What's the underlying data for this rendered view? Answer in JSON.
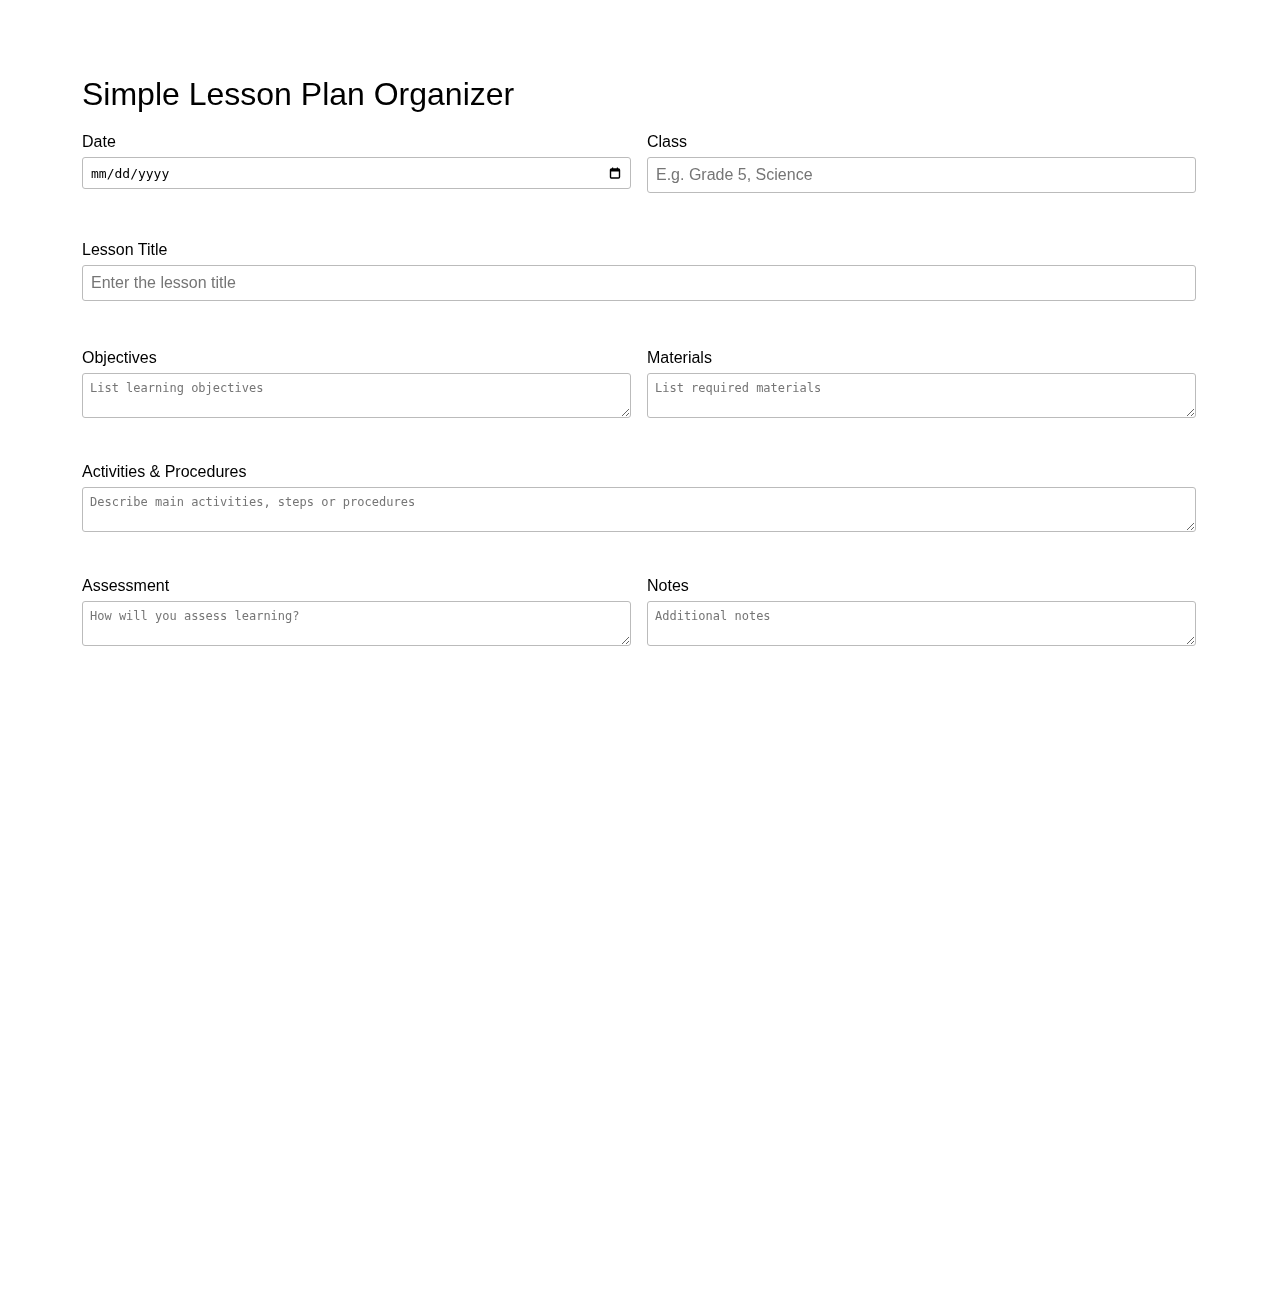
{
  "title": "Simple Lesson Plan Organizer",
  "rows": [
    {
      "fields": [
        {
          "label": "Date",
          "kind": "date",
          "placeholder": "mm/dd/yyyy"
        },
        {
          "label": "Class",
          "kind": "text",
          "placeholder": "E.g. Grade 5, Science"
        }
      ]
    },
    {
      "fields": [
        {
          "label": "Lesson Title",
          "kind": "text",
          "placeholder": "Enter the lesson title"
        }
      ]
    },
    {
      "fields": [
        {
          "label": "Objectives",
          "kind": "textarea",
          "placeholder": "List learning objectives"
        },
        {
          "label": "Materials",
          "kind": "textarea",
          "placeholder": "List required materials"
        }
      ]
    },
    {
      "fields": [
        {
          "label": "Activities & Procedures",
          "kind": "textarea",
          "placeholder": "Describe main activities, steps or procedures"
        }
      ]
    },
    {
      "fields": [
        {
          "label": "Assessment",
          "kind": "textarea",
          "placeholder": "How will you assess learning?"
        },
        {
          "label": "Notes",
          "kind": "textarea",
          "placeholder": "Additional notes"
        }
      ]
    }
  ]
}
